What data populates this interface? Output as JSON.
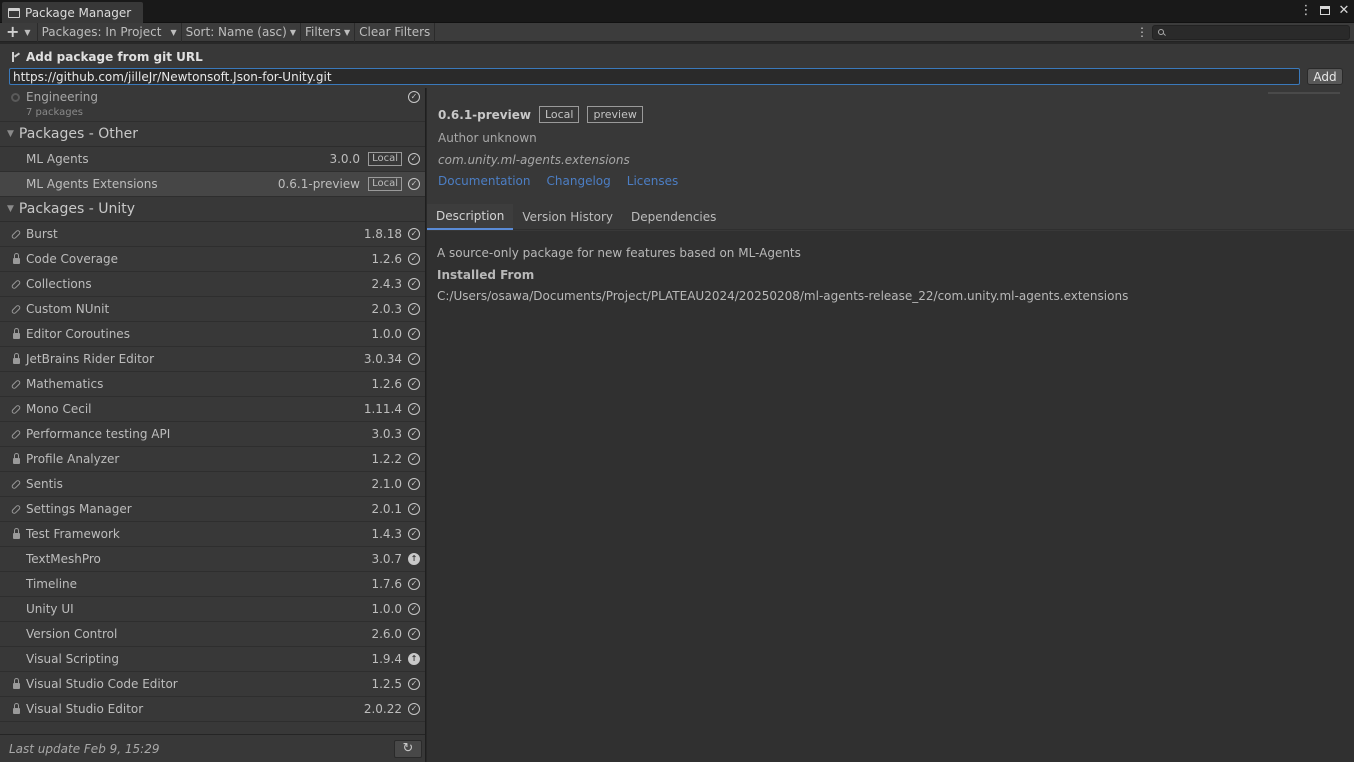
{
  "window": {
    "title": "Package Manager"
  },
  "toolbar": {
    "packages_label": "Packages: In Project",
    "sort_label": "Sort: Name (asc)",
    "filters_label": "Filters",
    "clear_filters_label": "Clear Filters",
    "search_placeholder": ""
  },
  "git_popup": {
    "title": "Add package from git URL",
    "url_value": "https://github.com/jilleJr/Newtonsoft.Json-for-Unity.git",
    "add_label": "Add"
  },
  "list": {
    "engineering": {
      "name": "Engineering",
      "sub": "7 packages"
    },
    "groups": [
      {
        "title": "Packages - Other",
        "items": [
          {
            "name": "ML Agents",
            "version": "3.0.0",
            "badge": "Local",
            "icon": "none",
            "status": "installed"
          },
          {
            "name": "ML Agents Extensions",
            "version": "0.6.1-preview",
            "badge": "Local",
            "icon": "none",
            "status": "installed",
            "selected": true
          }
        ]
      },
      {
        "title": "Packages - Unity",
        "items": [
          {
            "name": "Burst",
            "version": "1.8.18",
            "icon": "link",
            "status": "installed"
          },
          {
            "name": "Code Coverage",
            "version": "1.2.6",
            "icon": "lock",
            "status": "installed"
          },
          {
            "name": "Collections",
            "version": "2.4.3",
            "icon": "link",
            "status": "installed"
          },
          {
            "name": "Custom NUnit",
            "version": "2.0.3",
            "icon": "link",
            "status": "installed"
          },
          {
            "name": "Editor Coroutines",
            "version": "1.0.0",
            "icon": "lock",
            "status": "installed"
          },
          {
            "name": "JetBrains Rider Editor",
            "version": "3.0.34",
            "icon": "lock",
            "status": "installed"
          },
          {
            "name": "Mathematics",
            "version": "1.2.6",
            "icon": "link",
            "status": "installed"
          },
          {
            "name": "Mono Cecil",
            "version": "1.11.4",
            "icon": "link",
            "status": "installed"
          },
          {
            "name": "Performance testing API",
            "version": "3.0.3",
            "icon": "link",
            "status": "installed"
          },
          {
            "name": "Profile Analyzer",
            "version": "1.2.2",
            "icon": "lock",
            "status": "installed"
          },
          {
            "name": "Sentis",
            "version": "2.1.0",
            "icon": "link",
            "status": "installed"
          },
          {
            "name": "Settings Manager",
            "version": "2.0.1",
            "icon": "link",
            "status": "installed"
          },
          {
            "name": "Test Framework",
            "version": "1.4.3",
            "icon": "lock",
            "status": "installed"
          },
          {
            "name": "TextMeshPro",
            "version": "3.0.7",
            "icon": "none",
            "status": "update"
          },
          {
            "name": "Timeline",
            "version": "1.7.6",
            "icon": "none",
            "status": "installed"
          },
          {
            "name": "Unity UI",
            "version": "1.0.0",
            "icon": "none",
            "status": "installed"
          },
          {
            "name": "Version Control",
            "version": "2.6.0",
            "icon": "none",
            "status": "installed"
          },
          {
            "name": "Visual Scripting",
            "version": "1.9.4",
            "icon": "none",
            "status": "update"
          },
          {
            "name": "Visual Studio Code Editor",
            "version": "1.2.5",
            "icon": "lock",
            "status": "installed"
          },
          {
            "name": "Visual Studio Editor",
            "version": "2.0.22",
            "icon": "lock",
            "status": "installed"
          }
        ]
      }
    ],
    "last_update": "Last update Feb 9, 15:29"
  },
  "detail": {
    "version": "0.6.1-preview",
    "tags": [
      "Local",
      "preview"
    ],
    "author": "Author unknown",
    "package_id": "com.unity.ml-agents.extensions",
    "links": [
      "Documentation",
      "Changelog",
      "Licenses"
    ],
    "tabs": [
      "Description",
      "Version History",
      "Dependencies"
    ],
    "active_tab": 0,
    "description": "A source-only package for new features based on ML-Agents",
    "installed_from_label": "Installed From",
    "installed_from_path": "C:/Users/osawa/Documents/Project/PLATEAU2024/20250208/ml-agents-release_22/com.unity.ml-agents.extensions"
  },
  "colors": {
    "link": "#4c7ec4",
    "accent": "#3a79bb",
    "panel": "#383838"
  }
}
